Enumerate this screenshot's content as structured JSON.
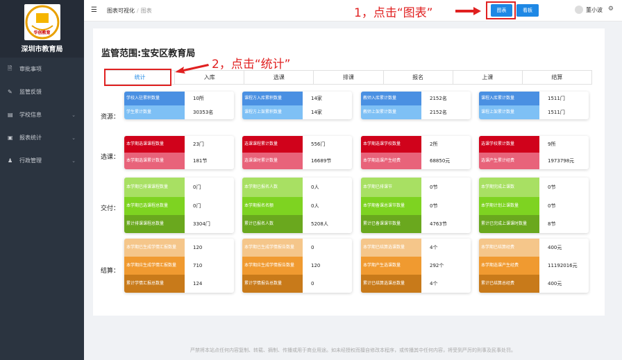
{
  "sidebar": {
    "brand": "深圳市教育局",
    "logo_text": "华创教育",
    "items": [
      {
        "label": "审批事项",
        "icon": "document-icon",
        "has_submenu": false
      },
      {
        "label": "监管反馈",
        "icon": "edit-icon",
        "has_submenu": false
      },
      {
        "label": "学校信息",
        "icon": "list-icon",
        "has_submenu": true
      },
      {
        "label": "报表统计",
        "icon": "chart-icon",
        "has_submenu": true
      },
      {
        "label": "行政管理",
        "icon": "user-icon",
        "has_submenu": true
      }
    ]
  },
  "header": {
    "crumb1": "图表可视化",
    "crumb_sep": "/",
    "crumb2": "图表",
    "btn_chart": "图表",
    "btn_board": "看板",
    "user": "董小波"
  },
  "annotations": {
    "a1": "1，点击“图表”",
    "a2": "2，点击“统计”"
  },
  "main": {
    "scope": "监管范围:宝安区教育局",
    "tabs": [
      "统计",
      "入库",
      "选课",
      "排课",
      "报名",
      "上课",
      "结算"
    ],
    "sections": [
      "资源：",
      "选课：",
      "交付：",
      "结算："
    ],
    "groups": [
      [
        {
          "label": "学校入驻累积数量",
          "value": "10所"
        },
        {
          "label": "学生累计数量",
          "value": "30353名"
        }
      ],
      [
        {
          "label": "课程方入库累积数量",
          "value": "14家"
        },
        {
          "label": "课程方上架累积数量",
          "value": "14家"
        }
      ],
      [
        {
          "label": "教师入库累计数量",
          "value": "2152名"
        },
        {
          "label": "教师上架累计数量",
          "value": "2152名"
        }
      ],
      [
        {
          "label": "课程入库累计数量",
          "value": "1511门"
        },
        {
          "label": "课程上架累计数量",
          "value": "1511门"
        }
      ],
      [
        {
          "label": "本学期选课课程数量",
          "value": "23门"
        },
        {
          "label": "本学期选课累计数量",
          "value": "181节"
        }
      ],
      [
        {
          "label": "选课课程累计数量",
          "value": "556门"
        },
        {
          "label": "选课课时累计数量",
          "value": "16689节"
        }
      ],
      [
        {
          "label": "本学期选课学校数量",
          "value": "2所"
        },
        {
          "label": "本学期选课产生经费",
          "value": "68850元"
        }
      ],
      [
        {
          "label": "选课学校累计数量",
          "value": "9所"
        },
        {
          "label": "选课产生累计经费",
          "value": "1973798元"
        }
      ],
      [
        {
          "label": "本学期已排课课程数量",
          "value": "0门"
        },
        {
          "label": "本学期已选课程总数量",
          "value": "0门"
        },
        {
          "label": "累计排课课程总数量",
          "value": "3304门"
        }
      ],
      [
        {
          "label": "本学期已报名人数",
          "value": "0人"
        },
        {
          "label": "本学期报名名额",
          "value": "0人"
        },
        {
          "label": "累计已报名人数",
          "value": "5208人"
        }
      ],
      [
        {
          "label": "本学期已排课节",
          "value": "0节"
        },
        {
          "label": "本学期备课总课节数量",
          "value": "0节"
        },
        {
          "label": "累计已备课课节数量",
          "value": "4763节"
        }
      ],
      [
        {
          "label": "本学期完成上课数",
          "value": "0节"
        },
        {
          "label": "本学期计划上课数量",
          "value": "0节"
        },
        {
          "label": "累计已完成上课课时数量",
          "value": "8节"
        }
      ],
      [
        {
          "label": "本学期已生成学情汇报数量",
          "value": "120"
        },
        {
          "label": "本学期应生成学情汇报数量",
          "value": "710"
        },
        {
          "label": "累计学情汇报总数量",
          "value": "124"
        }
      ],
      [
        {
          "label": "本学期已生成学情报告数量",
          "value": "0"
        },
        {
          "label": "本学期应生成学情报告数量",
          "value": "120"
        },
        {
          "label": "累计学情报告总数量",
          "value": "0"
        }
      ],
      [
        {
          "label": "本学期已结算选课数量",
          "value": "4个"
        },
        {
          "label": "本学期产生选课数量",
          "value": "292个"
        },
        {
          "label": "累计已结算选课总数量",
          "value": "4个"
        }
      ],
      [
        {
          "label": "本学期已结算经费",
          "value": "400元"
        },
        {
          "label": "本学期选课产生经费",
          "value": "11192016元"
        },
        {
          "label": "累计已结算总经费",
          "value": "400元"
        }
      ]
    ]
  },
  "footer": "严禁将本站点任何内容复制、转载、摘制、传播或用于商业用途。如未经授权而擅自修改本程序，或传播其中任何内容，将受到严厉的刑事及民事处罚。",
  "colors": {
    "accent": "#1e88e5",
    "annotation": "#e02020"
  }
}
